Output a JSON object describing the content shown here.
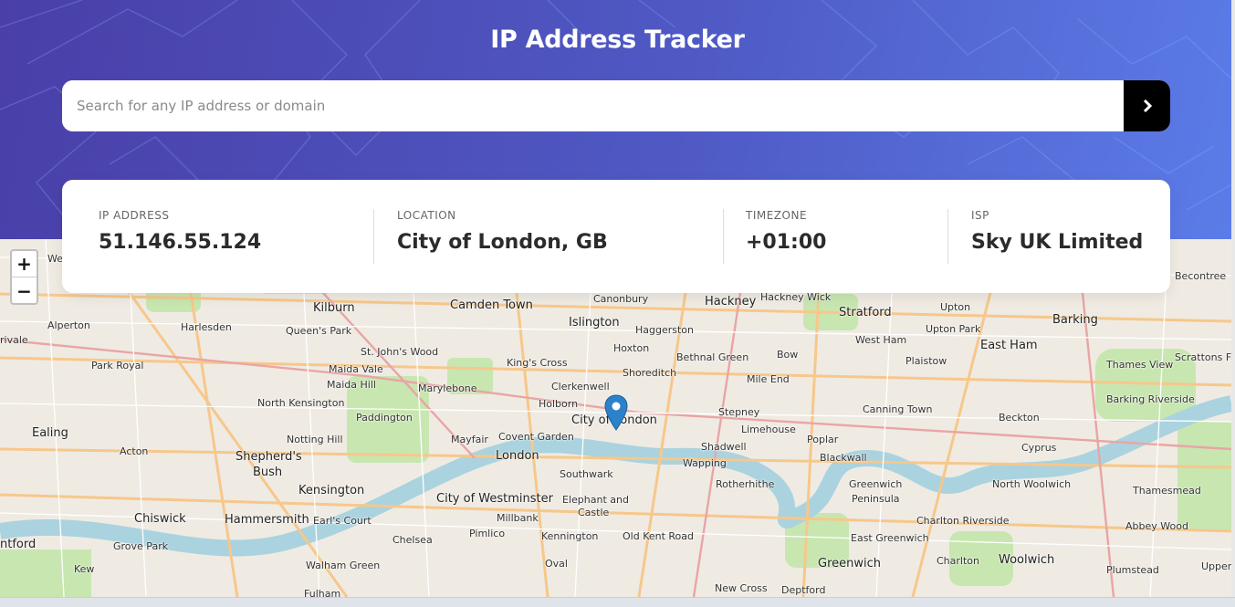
{
  "header": {
    "title": "IP Address Tracker",
    "search_placeholder": "Search for any IP address or domain",
    "submit_icon": "chevron-right-icon",
    "accent_colors": [
      "#4a3fa8",
      "#5b7ce8"
    ]
  },
  "info": {
    "ip_label": "IP ADDRESS",
    "ip_value": "51.146.55.124",
    "location_label": "LOCATION",
    "location_value": "City of London, GB",
    "timezone_label": "TIMEZONE",
    "timezone_value": "+01:00",
    "isp_label": "ISP",
    "isp_value": "Sky UK Limited"
  },
  "map": {
    "zoom_in": "+",
    "zoom_out": "−",
    "marker_icon": "location-pin-icon",
    "river_color": "#aad3df",
    "park_color": "#c8e6b0",
    "labels": [
      "Kilburn",
      "Camden Town",
      "Canonbury",
      "Hackney",
      "Hackney Wick",
      "Stratford",
      "Upton",
      "Barking",
      "Becontree",
      "Alperton",
      "Harlesden",
      "Queen's Park",
      "Islington",
      "Haggerston",
      "Upton Park",
      "Hoxton",
      "Bethnal Green",
      "Bow",
      "West Ham",
      "East Ham",
      "Scrattons Fa",
      "St. John's Wood",
      "King's Cross",
      "Plaistow",
      "Thames View",
      "Park Royal",
      "Maida Vale",
      "Maida Hill",
      "Marylebone",
      "Clerkenwell",
      "Shoreditch",
      "Mile End",
      "North Kensington",
      "Holborn",
      "Canning Town",
      "Barking Riverside",
      "Paddington",
      "City of London",
      "Stepney",
      "Ealing",
      "Notting Hill",
      "Mayfair",
      "Covent Garden",
      "Limehouse",
      "Beckton",
      "Acton",
      "Shepherd's",
      "Bush",
      "London",
      "Shadwell",
      "Poplar",
      "Blackwall",
      "Cyprus",
      "Wapping",
      "Southwark",
      "Kensington",
      "Rotherhithe",
      "Greenwich",
      "Peninsula",
      "North Woolwich",
      "Thamesmead",
      "City of Westminster",
      "Elephant and",
      "Castle",
      "Chiswick",
      "Hammersmith",
      "Earl's Court",
      "Millbank",
      "Charlton Riverside",
      "Abbey Wood",
      "Pimlico",
      "Kennington",
      "Old Kent Road",
      "East Greenwich",
      "Chelsea",
      "Grove Park",
      "Oval",
      "Charlton",
      "Woolwich",
      "Kew",
      "Walham Green",
      "Greenwich",
      "Plumstead",
      "New Cross",
      "Deptford",
      "Fulham",
      "Upper",
      "ntford",
      "We",
      "rivale"
    ]
  }
}
